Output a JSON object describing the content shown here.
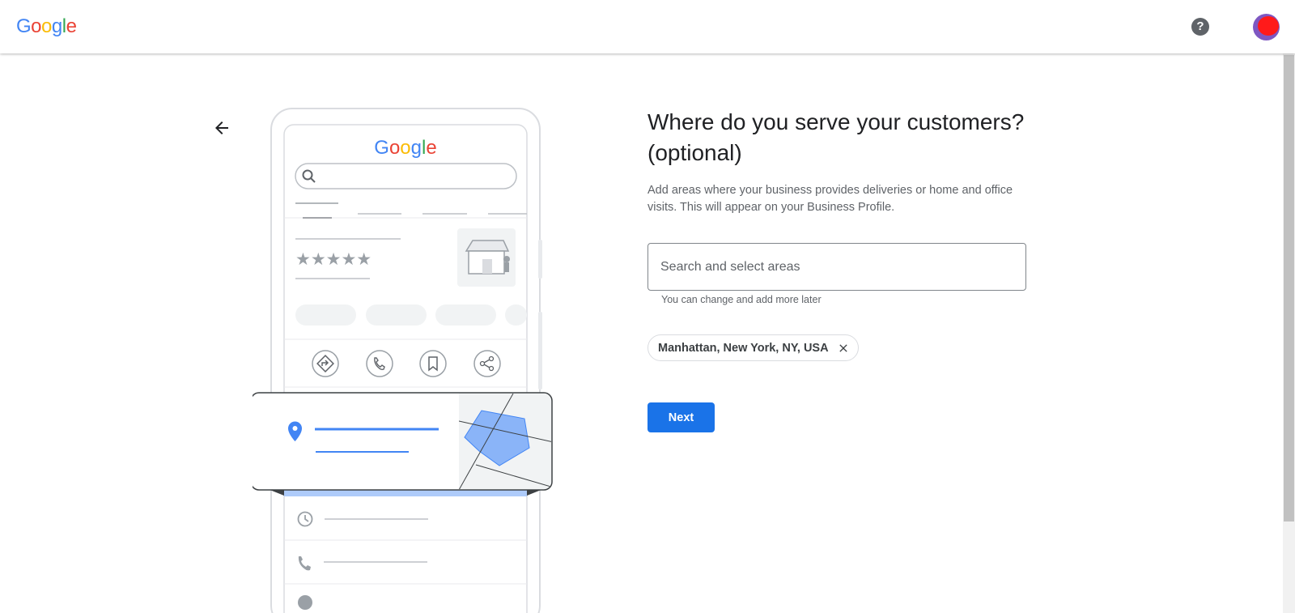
{
  "header": {
    "logo_letters": [
      {
        "ch": "G",
        "color": "#4285F4"
      },
      {
        "ch": "o",
        "color": "#EA4335"
      },
      {
        "ch": "o",
        "color": "#FBBC05"
      },
      {
        "ch": "g",
        "color": "#4285F4"
      },
      {
        "ch": "l",
        "color": "#34A853"
      },
      {
        "ch": "e",
        "color": "#EA4335"
      }
    ],
    "help_label": "?",
    "help_icon": "help-circle-icon",
    "avatar_icon": "account-avatar"
  },
  "illustration": {
    "logo_letters": [
      {
        "ch": "G",
        "color": "#4285F4"
      },
      {
        "ch": "o",
        "color": "#EA4335"
      },
      {
        "ch": "o",
        "color": "#FBBC05"
      },
      {
        "ch": "g",
        "color": "#4285F4"
      },
      {
        "ch": "l",
        "color": "#34A853"
      },
      {
        "ch": "e",
        "color": "#EA4335"
      }
    ],
    "stars": "★★★★★"
  },
  "main": {
    "title": "Where do you serve your customers? (optional)",
    "description": "Add areas where your business provides deliveries or home and office visits. This will appear on your Business Profile.",
    "search": {
      "placeholder": "Search and select areas",
      "value": ""
    },
    "helper_text": "You can change and add more later",
    "chips": [
      {
        "label": "Manhattan, New York, NY, USA"
      }
    ],
    "next_label": "Next"
  },
  "colors": {
    "accent": "#1a73e8",
    "map_blue": "#8ab4f8",
    "pin_blue": "#4285f4"
  }
}
